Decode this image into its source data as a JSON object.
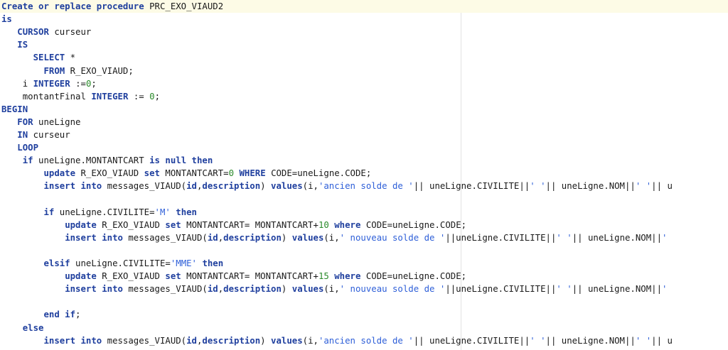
{
  "colors": {
    "keyword": "#1f3f9e",
    "number": "#2a8a2a",
    "string": "#2e5fd8",
    "plain": "#1a1a1a",
    "current_line": "#fdfbe6",
    "edge_line": "#e2e2e2"
  },
  "editor": {
    "lines": [
      {
        "indent": 0,
        "current": true,
        "tokens": [
          {
            "t": "kw",
            "v": "Create or replace procedure"
          },
          {
            "t": "p",
            "v": " PRC_EXO_VIAUD2"
          }
        ]
      },
      {
        "indent": 0,
        "tokens": [
          {
            "t": "kw",
            "v": "is"
          }
        ]
      },
      {
        "indent": 3,
        "tokens": [
          {
            "t": "kw",
            "v": "CURSOR"
          },
          {
            "t": "p",
            "v": " curseur"
          }
        ]
      },
      {
        "indent": 3,
        "tokens": [
          {
            "t": "kw",
            "v": "IS"
          }
        ]
      },
      {
        "indent": 6,
        "tokens": [
          {
            "t": "kw",
            "v": "SELECT"
          },
          {
            "t": "p",
            "v": " *"
          }
        ]
      },
      {
        "indent": 8,
        "tokens": [
          {
            "t": "kw",
            "v": "FROM"
          },
          {
            "t": "p",
            "v": " R_EXO_VIAUD;"
          }
        ]
      },
      {
        "indent": 4,
        "tokens": [
          {
            "t": "p",
            "v": "i "
          },
          {
            "t": "kw",
            "v": "INTEGER"
          },
          {
            "t": "p",
            "v": " :="
          },
          {
            "t": "num",
            "v": "0"
          },
          {
            "t": "p",
            "v": ";"
          }
        ]
      },
      {
        "indent": 4,
        "tokens": [
          {
            "t": "p",
            "v": "montantFinal "
          },
          {
            "t": "kw",
            "v": "INTEGER"
          },
          {
            "t": "p",
            "v": " := "
          },
          {
            "t": "num",
            "v": "0"
          },
          {
            "t": "p",
            "v": ";"
          }
        ]
      },
      {
        "indent": 0,
        "tokens": [
          {
            "t": "kw",
            "v": "BEGIN"
          }
        ]
      },
      {
        "indent": 3,
        "tokens": [
          {
            "t": "kw",
            "v": "FOR"
          },
          {
            "t": "p",
            "v": " uneLigne"
          }
        ]
      },
      {
        "indent": 3,
        "tokens": [
          {
            "t": "kw",
            "v": "IN"
          },
          {
            "t": "p",
            "v": " curseur"
          }
        ]
      },
      {
        "indent": 3,
        "tokens": [
          {
            "t": "kw",
            "v": "LOOP"
          }
        ]
      },
      {
        "indent": 4,
        "tokens": [
          {
            "t": "kw",
            "v": "if"
          },
          {
            "t": "p",
            "v": " uneLigne.MONTANTCART "
          },
          {
            "t": "kw",
            "v": "is null then"
          }
        ]
      },
      {
        "indent": 8,
        "tokens": [
          {
            "t": "kw",
            "v": "update"
          },
          {
            "t": "p",
            "v": " R_EXO_VIAUD "
          },
          {
            "t": "kw",
            "v": "set"
          },
          {
            "t": "p",
            "v": " MONTANTCART="
          },
          {
            "t": "num",
            "v": "0"
          },
          {
            "t": "p",
            "v": " "
          },
          {
            "t": "kw",
            "v": "WHERE"
          },
          {
            "t": "p",
            "v": " CODE=uneLigne.CODE;"
          }
        ]
      },
      {
        "indent": 8,
        "tokens": [
          {
            "t": "kw",
            "v": "insert into"
          },
          {
            "t": "p",
            "v": " messages_VIAUD("
          },
          {
            "t": "kw",
            "v": "id"
          },
          {
            "t": "p",
            "v": ","
          },
          {
            "t": "kw",
            "v": "description"
          },
          {
            "t": "p",
            "v": ") "
          },
          {
            "t": "kw",
            "v": "values"
          },
          {
            "t": "p",
            "v": "(i,"
          },
          {
            "t": "str",
            "v": "'ancien solde de '"
          },
          {
            "t": "p",
            "v": "|| uneLigne.CIVILITE||"
          },
          {
            "t": "str",
            "v": "' '"
          },
          {
            "t": "p",
            "v": "|| uneLigne.NOM||"
          },
          {
            "t": "str",
            "v": "' '"
          },
          {
            "t": "p",
            "v": "|| u"
          }
        ]
      },
      {
        "indent": 0,
        "tokens": []
      },
      {
        "indent": 8,
        "tokens": [
          {
            "t": "kw",
            "v": "if"
          },
          {
            "t": "p",
            "v": " uneLigne.CIVILITE="
          },
          {
            "t": "str",
            "v": "'M'"
          },
          {
            "t": "p",
            "v": " "
          },
          {
            "t": "kw",
            "v": "then"
          }
        ]
      },
      {
        "indent": 12,
        "tokens": [
          {
            "t": "kw",
            "v": "update"
          },
          {
            "t": "p",
            "v": " R_EXO_VIAUD "
          },
          {
            "t": "kw",
            "v": "set"
          },
          {
            "t": "p",
            "v": " MONTANTCART= MONTANTCART+"
          },
          {
            "t": "num",
            "v": "10"
          },
          {
            "t": "p",
            "v": " "
          },
          {
            "t": "kw",
            "v": "where"
          },
          {
            "t": "p",
            "v": " CODE=uneLigne.CODE;"
          }
        ]
      },
      {
        "indent": 12,
        "tokens": [
          {
            "t": "kw",
            "v": "insert into"
          },
          {
            "t": "p",
            "v": " messages_VIAUD("
          },
          {
            "t": "kw",
            "v": "id"
          },
          {
            "t": "p",
            "v": ","
          },
          {
            "t": "kw",
            "v": "description"
          },
          {
            "t": "p",
            "v": ") "
          },
          {
            "t": "kw",
            "v": "values"
          },
          {
            "t": "p",
            "v": "(i,"
          },
          {
            "t": "str",
            "v": "' nouveau solde de '"
          },
          {
            "t": "p",
            "v": "||uneLigne.CIVILITE||"
          },
          {
            "t": "str",
            "v": "' '"
          },
          {
            "t": "p",
            "v": "|| uneLigne.NOM||"
          },
          {
            "t": "str",
            "v": "'"
          }
        ]
      },
      {
        "indent": 0,
        "tokens": []
      },
      {
        "indent": 8,
        "tokens": [
          {
            "t": "kw",
            "v": "elsif"
          },
          {
            "t": "p",
            "v": " uneLigne.CIVILITE="
          },
          {
            "t": "str",
            "v": "'MME'"
          },
          {
            "t": "p",
            "v": " "
          },
          {
            "t": "kw",
            "v": "then"
          }
        ]
      },
      {
        "indent": 12,
        "tokens": [
          {
            "t": "kw",
            "v": "update"
          },
          {
            "t": "p",
            "v": " R_EXO_VIAUD "
          },
          {
            "t": "kw",
            "v": "set"
          },
          {
            "t": "p",
            "v": " MONTANTCART= MONTANTCART+"
          },
          {
            "t": "num",
            "v": "15"
          },
          {
            "t": "p",
            "v": " "
          },
          {
            "t": "kw",
            "v": "where"
          },
          {
            "t": "p",
            "v": " CODE=uneLigne.CODE;"
          }
        ]
      },
      {
        "indent": 12,
        "tokens": [
          {
            "t": "kw",
            "v": "insert into"
          },
          {
            "t": "p",
            "v": " messages_VIAUD("
          },
          {
            "t": "kw",
            "v": "id"
          },
          {
            "t": "p",
            "v": ","
          },
          {
            "t": "kw",
            "v": "description"
          },
          {
            "t": "p",
            "v": ") "
          },
          {
            "t": "kw",
            "v": "values"
          },
          {
            "t": "p",
            "v": "(i,"
          },
          {
            "t": "str",
            "v": "' nouveau solde de '"
          },
          {
            "t": "p",
            "v": "||uneLigne.CIVILITE||"
          },
          {
            "t": "str",
            "v": "' '"
          },
          {
            "t": "p",
            "v": "|| uneLigne.NOM||"
          },
          {
            "t": "str",
            "v": "'"
          }
        ]
      },
      {
        "indent": 0,
        "tokens": []
      },
      {
        "indent": 8,
        "tokens": [
          {
            "t": "kw",
            "v": "end if"
          },
          {
            "t": "p",
            "v": ";"
          }
        ]
      },
      {
        "indent": 4,
        "tokens": [
          {
            "t": "kw",
            "v": "else"
          }
        ]
      },
      {
        "indent": 8,
        "tokens": [
          {
            "t": "kw",
            "v": "insert into"
          },
          {
            "t": "p",
            "v": " messages_VIAUD("
          },
          {
            "t": "kw",
            "v": "id"
          },
          {
            "t": "p",
            "v": ","
          },
          {
            "t": "kw",
            "v": "description"
          },
          {
            "t": "p",
            "v": ") "
          },
          {
            "t": "kw",
            "v": "values"
          },
          {
            "t": "p",
            "v": "(i,"
          },
          {
            "t": "str",
            "v": "'ancien solde de '"
          },
          {
            "t": "p",
            "v": "|| uneLigne.CIVILITE||"
          },
          {
            "t": "str",
            "v": "' '"
          },
          {
            "t": "p",
            "v": "|| uneLigne.NOM||"
          },
          {
            "t": "str",
            "v": "' '"
          },
          {
            "t": "p",
            "v": "|| u"
          }
        ]
      }
    ]
  }
}
